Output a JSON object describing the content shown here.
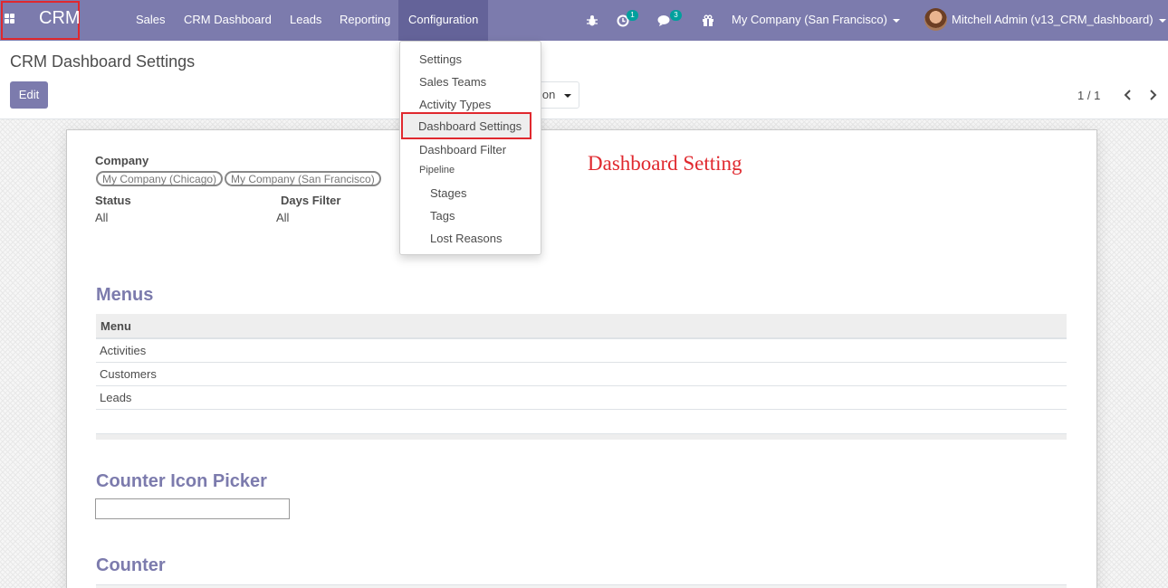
{
  "navbar": {
    "app_name": "CRM",
    "menu": [
      "Sales",
      "CRM Dashboard",
      "Leads",
      "Reporting",
      "Configuration"
    ],
    "activity_count": "1",
    "message_count": "3",
    "company": "My Company (San Francisco)",
    "user": "Mitchell Admin (v13_CRM_dashboard)",
    "colors": {
      "navbar": "#7c7bad",
      "active": "#646399",
      "badge": "#00a09d",
      "highlight": "#e0282e"
    }
  },
  "control": {
    "breadcrumb": "CRM Dashboard Settings",
    "edit_label": "Edit",
    "action_label_partial": "ion",
    "pager": "1 / 1"
  },
  "dropdown": {
    "items": [
      "Settings",
      "Sales Teams",
      "Activity Types",
      "Dashboard Settings",
      "Dashboard Filter"
    ],
    "pipeline_header": "Pipeline",
    "pipeline_items": [
      "Stages",
      "Tags",
      "Lost Reasons"
    ]
  },
  "form": {
    "company_label": "Company",
    "companies": [
      "My Company (Chicago)",
      "My Company (San Francisco)"
    ],
    "status_label": "Status",
    "status_value": "All",
    "days_filter_label": "Days Filter",
    "days_filter_value": "All",
    "heading": "Dashboard Setting",
    "menus_title": "Menus",
    "menus_column": "Menu",
    "menu_rows": [
      "Activities",
      "Customers",
      "Leads"
    ],
    "icon_picker_title": "Counter Icon Picker",
    "icon_picker_value": "",
    "counter_title": "Counter"
  }
}
